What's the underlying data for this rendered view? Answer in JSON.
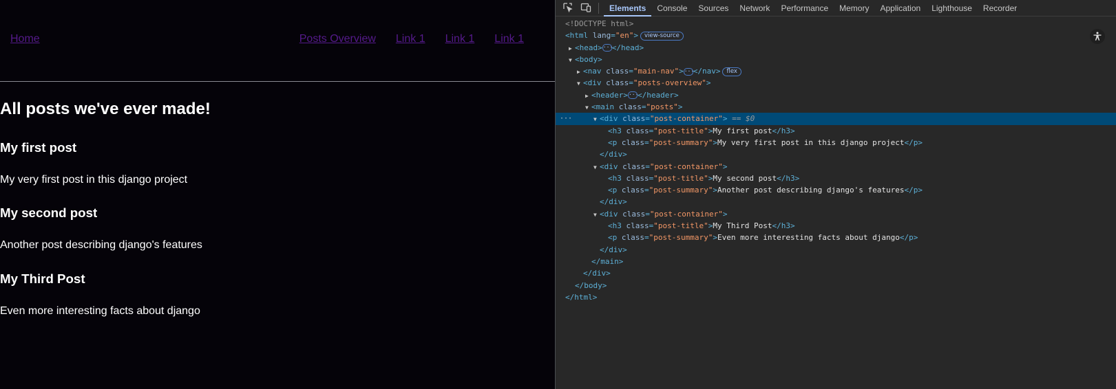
{
  "page": {
    "nav": {
      "home": "Home",
      "links": [
        "Posts Overview",
        "Link 1",
        "Link 1",
        "Link 1"
      ]
    },
    "heading": "All posts we've ever made!",
    "posts": [
      {
        "title": "My first post",
        "summary": "My very first post in this django project"
      },
      {
        "title": "My second post",
        "summary": "Another post describing django's features"
      },
      {
        "title": "My Third Post",
        "summary": "Even more interesting facts about django"
      }
    ]
  },
  "devtools": {
    "tabs": [
      "Elements",
      "Console",
      "Sources",
      "Network",
      "Performance",
      "Memory",
      "Application",
      "Lighthouse",
      "Recorder"
    ],
    "active_tab": "Elements",
    "icons": [
      "inspect-element-icon",
      "device-toolbar-icon",
      "accessibility-icon"
    ],
    "badges": {
      "view_source": "view-source",
      "flex": "flex",
      "selected_marker": "== $0"
    },
    "dom": {
      "doctype": "<!DOCTYPE html>",
      "html_lang": "en",
      "nav_class": "main-nav",
      "posts_overview_class": "posts-overview",
      "main_class": "posts",
      "post_container_class": "post-container",
      "post_title_class": "post-title",
      "post_summary_class": "post-summary"
    },
    "colors": {
      "tag": "#5db0d7",
      "attribute": "#9bbbdc",
      "value": "#f29766",
      "selected_row": "#004a77",
      "active_tab": "#a8c7fa"
    }
  }
}
